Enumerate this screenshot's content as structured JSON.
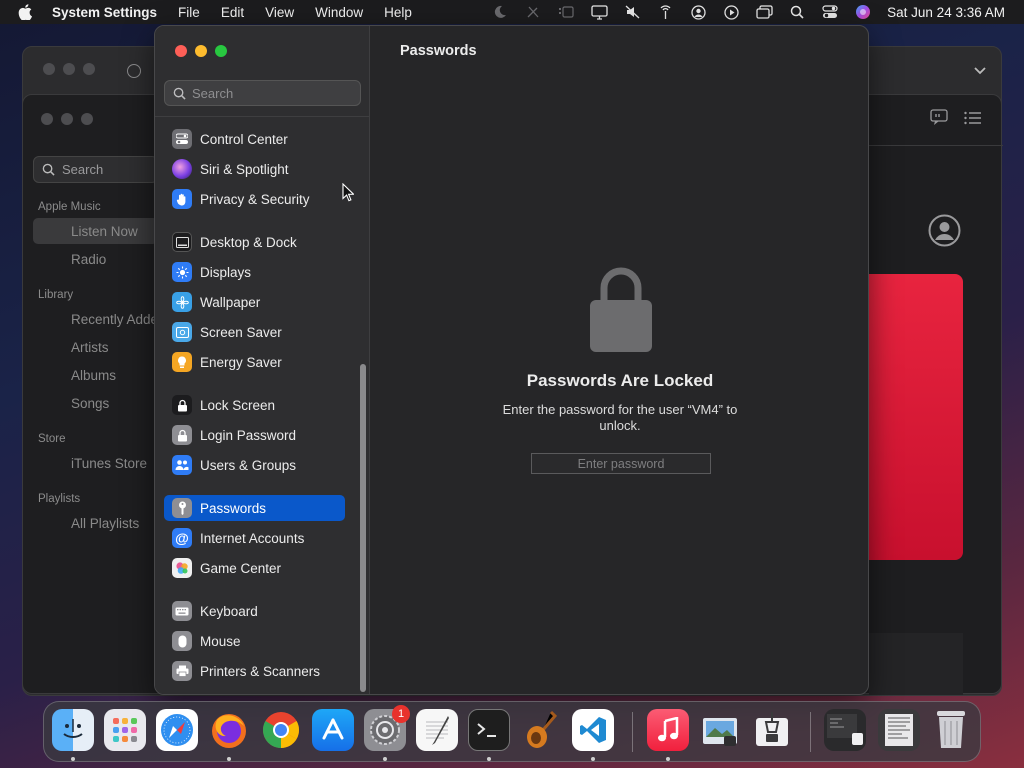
{
  "menubar": {
    "app_name": "System Settings",
    "menus": [
      "File",
      "Edit",
      "View",
      "Window",
      "Help"
    ],
    "status_icons": [
      "moon-icon",
      "pen-slash-icon",
      "stage-manager-icon",
      "display-icon",
      "mute-icon",
      "antenna-icon",
      "user-circle-icon",
      "play-circle-icon",
      "windows-icon",
      "search-icon",
      "control-center-icon",
      "siri-icon"
    ],
    "clock": "Sat Jun 24  3:36 AM"
  },
  "music_window": {
    "search_placeholder": "Search",
    "sections": [
      {
        "title": "Apple Music",
        "items": [
          "Listen Now",
          "Radio"
        ]
      },
      {
        "title": "Library",
        "items": [
          "Recently Added",
          "Artists",
          "Albums",
          "Songs"
        ]
      },
      {
        "title": "Store",
        "items": [
          "iTunes Store"
        ]
      },
      {
        "title": "Playlists",
        "items": [
          "All Playlists"
        ]
      }
    ]
  },
  "settings": {
    "search_placeholder": "Search",
    "sidebar": [
      {
        "label": "Control Center",
        "icon": "control-center-icon",
        "color": "#6e6e73"
      },
      {
        "label": "Siri & Spotlight",
        "icon": "siri-icon",
        "color": "#7b3fe4"
      },
      {
        "label": "Privacy & Security",
        "icon": "hand-icon",
        "color": "#2f7cf6"
      },
      {
        "label": "Desktop & Dock",
        "icon": "dock-icon",
        "color": "#1c1c1e"
      },
      {
        "label": "Displays",
        "icon": "sun-icon",
        "color": "#2f7cf6"
      },
      {
        "label": "Wallpaper",
        "icon": "flower-icon",
        "color": "#39a0e6"
      },
      {
        "label": "Screen Saver",
        "icon": "screen-saver-icon",
        "color": "#4aa8e8"
      },
      {
        "label": "Energy Saver",
        "icon": "bulb-icon",
        "color": "#f5a623"
      },
      {
        "label": "Lock Screen",
        "icon": "lock-icon",
        "color": "#1c1c1e"
      },
      {
        "label": "Login Password",
        "icon": "lock-icon",
        "color": "#8e8e93"
      },
      {
        "label": "Users & Groups",
        "icon": "users-icon",
        "color": "#2f7cf6"
      },
      {
        "label": "Passwords",
        "icon": "key-icon",
        "color": "#8e8e93",
        "selected": true
      },
      {
        "label": "Internet Accounts",
        "icon": "at-icon",
        "color": "#2f7cf6"
      },
      {
        "label": "Game Center",
        "icon": "game-center-icon",
        "color": "#e9e9ea"
      },
      {
        "label": "Keyboard",
        "icon": "keyboard-icon",
        "color": "#8e8e93"
      },
      {
        "label": "Mouse",
        "icon": "mouse-icon",
        "color": "#8e8e93"
      },
      {
        "label": "Printers & Scanners",
        "icon": "printer-icon",
        "color": "#8e8e93"
      }
    ],
    "pane_title": "Passwords",
    "locked_title": "Passwords Are Locked",
    "locked_message": "Enter the password for the user “VM4” to unlock.",
    "password_placeholder": "Enter password"
  },
  "dock": {
    "items": [
      "Finder",
      "Launchpad",
      "Safari",
      "Firefox",
      "Chrome",
      "App Store",
      "System Settings",
      "TextEdit",
      "Terminal",
      "GarageBand",
      "Visual Studio Code",
      "Music",
      "Preview",
      "Archive Utility",
      "Recent Document 1",
      "Recent Document 2",
      "Trash"
    ],
    "settings_badge": "1"
  }
}
